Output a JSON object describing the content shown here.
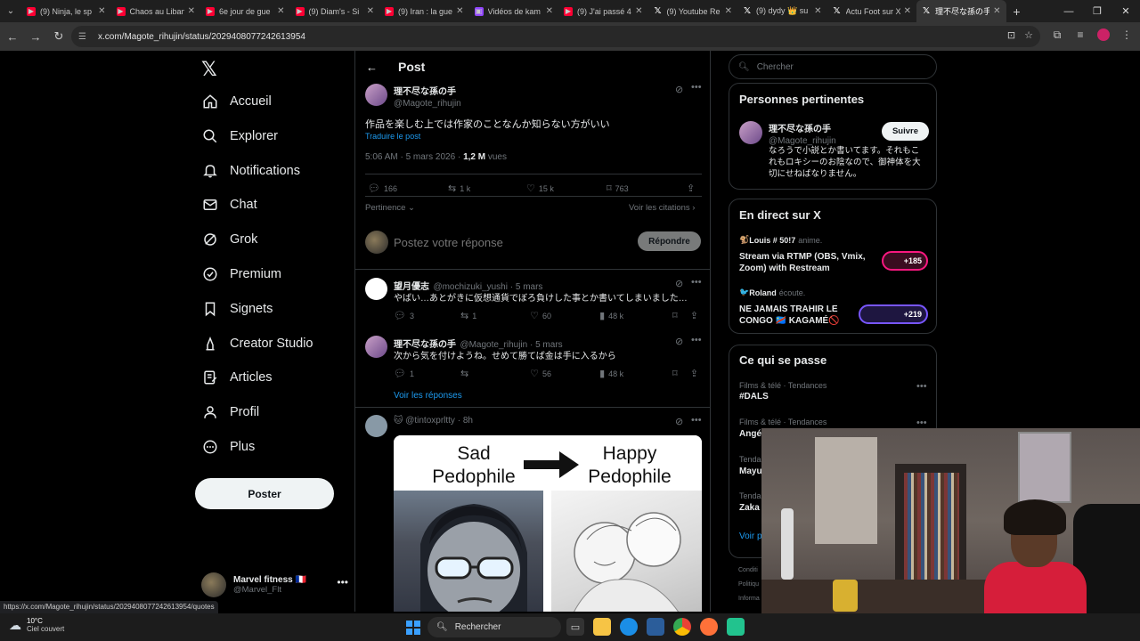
{
  "browser": {
    "tabs": [
      {
        "label": "(9) Ninja, le sp",
        "icon": "youtube-icon"
      },
      {
        "label": "Chaos au Liban",
        "icon": "youtube-icon"
      },
      {
        "label": "6e jour de gue",
        "icon": "youtube-icon"
      },
      {
        "label": "(9) Diam's - Si",
        "icon": "youtube-icon"
      },
      {
        "label": "(9) Iran : la gue",
        "icon": "youtube-icon"
      },
      {
        "label": "Vidéos de kam",
        "icon": "twitch-icon"
      },
      {
        "label": "(9) J'ai passé 4",
        "icon": "youtube-icon"
      },
      {
        "label": "(9) Youtube Re",
        "icon": "x-icon"
      },
      {
        "label": "(9) dydy 👑 su",
        "icon": "x-icon"
      },
      {
        "label": "Actu Foot sur X",
        "icon": "x-icon"
      },
      {
        "label": "理不尽な孫の手",
        "icon": "x-icon",
        "active": true
      }
    ],
    "url": "x.com/Magote_rihujin/status/2029408077242613954",
    "status_url": "https://x.com/Magote_rihujin/status/2029408077242613954/quotes"
  },
  "nav": {
    "items": [
      {
        "label": "Accueil",
        "icon": "home-icon"
      },
      {
        "label": "Explorer",
        "icon": "search-icon"
      },
      {
        "label": "Notifications",
        "icon": "bell-icon"
      },
      {
        "label": "Chat",
        "icon": "mail-icon"
      },
      {
        "label": "Grok",
        "icon": "grok-icon"
      },
      {
        "label": "Premium",
        "icon": "verified-icon"
      },
      {
        "label": "Signets",
        "icon": "bookmark-icon"
      },
      {
        "label": "Creator Studio",
        "icon": "creator-icon"
      },
      {
        "label": "Articles",
        "icon": "article-icon"
      },
      {
        "label": "Profil",
        "icon": "person-icon"
      },
      {
        "label": "Plus",
        "icon": "more-circle-icon"
      }
    ],
    "post_label": "Poster",
    "account": {
      "name": "Marvel fitness 🇫🇷",
      "handle": "@Marvel_Flt"
    }
  },
  "main": {
    "title": "Post",
    "post": {
      "name": "理不尽な孫の手",
      "handle": "@Magote_rihujin",
      "text": "作品を楽しむ上では作家のことなんか知らない方がいい",
      "translate": "Traduire le post",
      "time": "5:06 AM · 5 mars 2026 · ",
      "views_count": "1,2 M",
      "views_label": " vues",
      "replies": "166",
      "reposts": "1 k",
      "likes": "15 k",
      "bookmarks": "763"
    },
    "sort_label": "Pertinence",
    "quotes_label": "Voir les citations",
    "reply_placeholder": "Postez votre réponse",
    "reply_button": "Répondre",
    "replies": [
      {
        "name": "望月優志",
        "meta": "@mochizuki_yushi · 5 mars",
        "text": "やばい…あとがきに仮想通貨でぼろ負けした事とか書いてしまいました…",
        "replies": "3",
        "reposts": "1",
        "likes": "60",
        "views": "48 k"
      },
      {
        "name": "理不尽な孫の手",
        "meta": "@Magote_rihujin · 5 mars",
        "text": "次から気を付けようね。せめて勝てば金は手に入るから",
        "replies": "1",
        "reposts": "",
        "likes": "56",
        "views": "48 k"
      }
    ],
    "show_replies": "Voir les réponses",
    "third": {
      "meta": "@tintoxprltty · 8h",
      "meme_left": "Sad Pedophile",
      "meme_right": "Happy Pedophile"
    }
  },
  "right": {
    "search_placeholder": "Chercher",
    "relevant": {
      "title": "Personnes pertinentes",
      "name": "理不尽な孫の手",
      "handle": "@Magote_rihujin",
      "follow": "Suivre",
      "bio": "なろうで小説とか書いてます。それもこれもロキシーのお陰なので、御神体を大切にせねばなりません。"
    },
    "live": {
      "title": "En direct sur X",
      "items": [
        {
          "host": "Louis # 50!7",
          "status": "anime.",
          "title": "Stream via RTMP (OBS, Vmix, Zoom) with Restream",
          "count": "+185",
          "color": "#f91880"
        },
        {
          "host": "Roland",
          "status": "écoute.",
          "title": "NE JAMAIS TRAHIR LE CONGO 🇨🇩 KAGAMÉ🚫",
          "count": "+219",
          "color": "#7856ff"
        }
      ]
    },
    "trends": {
      "title": "Ce qui se passe",
      "items": [
        {
          "meta": "Films & télé · Tendances",
          "name": "#DALS"
        },
        {
          "meta": "Films & télé · Tendances",
          "name": "Angé"
        },
        {
          "meta": "Tendan",
          "name": "Mayu"
        },
        {
          "meta": "Tendan",
          "name": "Zaka"
        }
      ],
      "see_more": "Voir p"
    },
    "footer": [
      "Conditi",
      "Politiqu",
      "Informa"
    ]
  },
  "taskbar": {
    "temp": "10°C",
    "weather": "Ciel couvert",
    "search": "Rechercher"
  },
  "colors": {
    "accent": "#1d9bf0",
    "background": "#000000",
    "border": "#2f3336",
    "muted": "#71767b"
  }
}
